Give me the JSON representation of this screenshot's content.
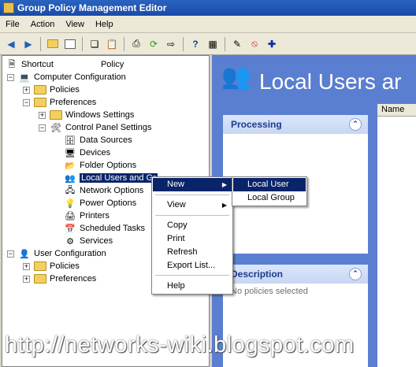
{
  "window": {
    "title": "Group Policy Management Editor"
  },
  "menubar": [
    "File",
    "Action",
    "View",
    "Help"
  ],
  "toolbar": {
    "icons": [
      "back-icon",
      "forward-icon",
      "up-folder-icon",
      "show-hide-tree-icon",
      "copy-icon",
      "paste-icon",
      "print-icon",
      "refresh-icon",
      "export-icon",
      "help-icon",
      "properties-icon",
      "add-icon",
      "stop-icon",
      "plus-icon"
    ]
  },
  "tree": {
    "root": "Shortcut",
    "root_suffix": "Policy",
    "computer": "Computer Configuration",
    "c_policies": "Policies",
    "c_preferences": "Preferences",
    "windows_settings": "Windows Settings",
    "control_panel": "Control Panel Settings",
    "items": [
      "Data Sources",
      "Devices",
      "Folder Options",
      "Local Users and Gr",
      "Network Options",
      "Power Options",
      "Printers",
      "Scheduled Tasks",
      "Services"
    ],
    "user": "User Configuration",
    "u_policies": "Policies",
    "u_preferences": "Preferences"
  },
  "right": {
    "title": "Local Users ar",
    "processing": "Processing",
    "description": "Description",
    "no_policies": "No policies selected",
    "column_name": "Name"
  },
  "context_menu": {
    "new": "New",
    "view": "View",
    "copy": "Copy",
    "print": "Print",
    "refresh": "Refresh",
    "export": "Export List...",
    "help": "Help"
  },
  "submenu": {
    "local_user": "Local User",
    "local_group": "Local Group"
  },
  "watermark": "http://networks-wiki.blogspot.com"
}
